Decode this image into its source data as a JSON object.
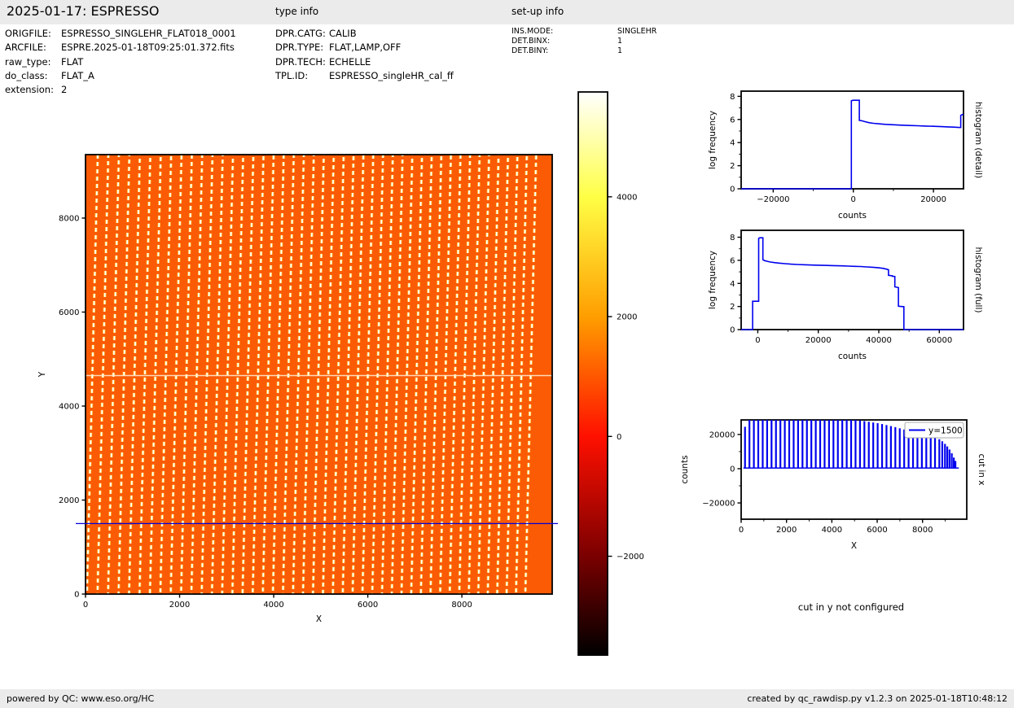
{
  "header": {
    "title": "2025-01-17: ESPRESSO",
    "type_info_label": "type info",
    "setup_info_label": "set-up info"
  },
  "file_info": {
    "rows": [
      {
        "label": "ORIGFILE:",
        "value": "ESPRESSO_SINGLEHR_FLAT018_0001"
      },
      {
        "label": "ARCFILE:",
        "value": "ESPRE.2025-01-18T09:25:01.372.fits"
      },
      {
        "label": "raw_type:",
        "value": "FLAT"
      },
      {
        "label": "do_class:",
        "value": "FLAT_A"
      },
      {
        "label": "extension:",
        "value": "2"
      }
    ]
  },
  "type_info": {
    "rows": [
      {
        "label": "DPR.CATG:",
        "value": "CALIB"
      },
      {
        "label": "DPR.TYPE:",
        "value": "FLAT,LAMP,OFF"
      },
      {
        "label": "DPR.TECH:",
        "value": "ECHELLE"
      },
      {
        "label": "TPL.ID:",
        "value": "ESPRESSO_singleHR_cal_ff"
      }
    ]
  },
  "setup_info": {
    "rows": [
      {
        "label": "INS.MODE:",
        "value": "SINGLEHR"
      },
      {
        "label": "DET.BINX:",
        "value": "1"
      },
      {
        "label": "DET.BINY:",
        "value": "1"
      }
    ]
  },
  "footer": {
    "left": "powered by QC: www.eso.org/HC",
    "right": "created by qc_rawdisp.py v1.2.3 on 2025-01-18T10:48:12"
  },
  "colors": {
    "accent_blue": "#0000ee",
    "image_orange": "#fa5b04",
    "bar_gray": "#ebebeb"
  },
  "chart_data": [
    {
      "id": "main-image",
      "type": "heatmap",
      "description": "ESPRESSO raw flat-field frame: near-vertical dashed echelle order traces (white/yellow) on orange background, hot colormap",
      "xlabel": "X",
      "ylabel": "Y",
      "xlim": [
        0,
        9920
      ],
      "ylim": [
        0,
        9350
      ],
      "xticks": [
        0,
        2000,
        4000,
        6000,
        8000
      ],
      "yticks": [
        0,
        2000,
        4000,
        6000,
        8000
      ],
      "bg_color": "#fa5b04",
      "orders": {
        "count": 45,
        "first_top_x": 260,
        "spacing": 225,
        "spacing_shrink": 0.3,
        "tilt_dx": -230,
        "dash_color": "#ffffff",
        "fringe_color": "#ffce45"
      },
      "detector_gap_y": 4650,
      "cut_line": {
        "y": 1500,
        "color": "#0000dd"
      }
    },
    {
      "id": "colorbar",
      "type": "colorbar",
      "colormap": "hot",
      "vmin": -3650,
      "vmax": 5750,
      "ticks": [
        4000,
        2000,
        0,
        -2000
      ],
      "gradient_stops": [
        [
          0.0,
          "#000000"
        ],
        [
          0.176,
          "#7b0000"
        ],
        [
          0.388,
          "#ff1000"
        ],
        [
          0.601,
          "#ff9e00"
        ],
        [
          0.814,
          "#ffff46"
        ],
        [
          1.0,
          "#ffffff"
        ]
      ]
    },
    {
      "id": "hist-detail",
      "type": "line",
      "xlabel": "counts",
      "ylabel": "log frequency",
      "right_label": "histogram (detail)",
      "xlim": [
        -28000,
        27500
      ],
      "ylim": [
        0,
        8.45
      ],
      "xticks": [
        -20000,
        0,
        20000
      ],
      "xminor": [
        -10000,
        10000
      ],
      "yticks": [
        0,
        2,
        4,
        6,
        8
      ],
      "yminor": [
        1,
        3,
        5,
        7
      ],
      "color": "#0000ee",
      "points": [
        [
          -28000,
          0
        ],
        [
          -500,
          0
        ],
        [
          -500,
          7.62
        ],
        [
          -100,
          7.66
        ],
        [
          1500,
          7.66
        ],
        [
          1500,
          5.92
        ],
        [
          2200,
          5.88
        ],
        [
          3000,
          5.8
        ],
        [
          4000,
          5.72
        ],
        [
          5000,
          5.67
        ],
        [
          6500,
          5.62
        ],
        [
          8000,
          5.58
        ],
        [
          10000,
          5.54
        ],
        [
          12000,
          5.51
        ],
        [
          14000,
          5.48
        ],
        [
          16000,
          5.46
        ],
        [
          18000,
          5.43
        ],
        [
          20000,
          5.41
        ],
        [
          22000,
          5.38
        ],
        [
          23500,
          5.36
        ],
        [
          25000,
          5.34
        ],
        [
          26300,
          5.31
        ],
        [
          26800,
          5.3
        ],
        [
          26800,
          6.35
        ],
        [
          27200,
          6.42
        ],
        [
          27500,
          6.45
        ]
      ]
    },
    {
      "id": "hist-full",
      "type": "line",
      "xlabel": "counts",
      "ylabel": "log frequency",
      "right_label": "histogram (full)",
      "xlim": [
        -5500,
        68000
      ],
      "ylim": [
        0,
        8.6
      ],
      "xticks": [
        0,
        20000,
        40000,
        60000
      ],
      "xminor": [
        10000,
        30000,
        50000
      ],
      "yticks": [
        0,
        2,
        4,
        6,
        8
      ],
      "yminor": [
        1,
        3,
        5,
        7
      ],
      "color": "#0000ee",
      "points": [
        [
          -5500,
          0
        ],
        [
          -1700,
          0
        ],
        [
          -1700,
          2.45
        ],
        [
          300,
          2.45
        ],
        [
          300,
          7.9
        ],
        [
          700,
          7.95
        ],
        [
          1700,
          7.95
        ],
        [
          1700,
          6.05
        ],
        [
          2200,
          5.98
        ],
        [
          3000,
          5.92
        ],
        [
          4000,
          5.86
        ],
        [
          5500,
          5.8
        ],
        [
          7000,
          5.76
        ],
        [
          9000,
          5.71
        ],
        [
          11000,
          5.67
        ],
        [
          13000,
          5.64
        ],
        [
          16000,
          5.61
        ],
        [
          19000,
          5.58
        ],
        [
          22000,
          5.56
        ],
        [
          25000,
          5.54
        ],
        [
          28000,
          5.52
        ],
        [
          30000,
          5.5
        ],
        [
          32000,
          5.48
        ],
        [
          34000,
          5.46
        ],
        [
          36000,
          5.43
        ],
        [
          38000,
          5.4
        ],
        [
          40000,
          5.35
        ],
        [
          41500,
          5.3
        ],
        [
          42500,
          5.24
        ],
        [
          43200,
          5.18
        ],
        [
          43200,
          4.7
        ],
        [
          44500,
          4.66
        ],
        [
          44500,
          4.62
        ],
        [
          45300,
          4.6
        ],
        [
          45300,
          3.7
        ],
        [
          46500,
          3.64
        ],
        [
          46500,
          2.02
        ],
        [
          48300,
          1.98
        ],
        [
          48300,
          0
        ],
        [
          68000,
          0
        ]
      ]
    },
    {
      "id": "cut-x",
      "type": "spikes",
      "xlabel": "X",
      "ylabel": "counts",
      "right_label": "cut in x",
      "legend_label": "y=1500",
      "xlim": [
        0,
        9950
      ],
      "ylim": [
        -29500,
        28500
      ],
      "xticks": [
        0,
        2000,
        4000,
        6000,
        8000
      ],
      "xminor": [
        1000,
        3000,
        5000,
        7000,
        9000
      ],
      "yticks": [
        -20000,
        0,
        20000
      ],
      "yminor": [
        -10000,
        10000
      ],
      "baseline": 400,
      "color": "#0000ee",
      "spikes": [
        [
          170,
          24500
        ],
        [
          365,
          28500
        ],
        [
          560,
          28500
        ],
        [
          755,
          28500
        ],
        [
          950,
          28500
        ],
        [
          1145,
          28500
        ],
        [
          1340,
          28500
        ],
        [
          1535,
          28500
        ],
        [
          1730,
          28500
        ],
        [
          1925,
          28500
        ],
        [
          2120,
          28500
        ],
        [
          2315,
          28500
        ],
        [
          2510,
          28500
        ],
        [
          2705,
          28500
        ],
        [
          2900,
          28500
        ],
        [
          3095,
          28500
        ],
        [
          3290,
          28500
        ],
        [
          3485,
          28500
        ],
        [
          3680,
          28500
        ],
        [
          3875,
          28500
        ],
        [
          4070,
          28500
        ],
        [
          4265,
          28500
        ],
        [
          4460,
          28500
        ],
        [
          4655,
          28500
        ],
        [
          4850,
          28500
        ],
        [
          5045,
          28500
        ],
        [
          5240,
          28200
        ],
        [
          5435,
          27800
        ],
        [
          5630,
          27400
        ],
        [
          5825,
          27000
        ],
        [
          6020,
          26600
        ],
        [
          6215,
          26100
        ],
        [
          6410,
          25500
        ],
        [
          6605,
          24900
        ],
        [
          6800,
          24300
        ],
        [
          6995,
          23600
        ],
        [
          7190,
          22900
        ],
        [
          7385,
          22100
        ],
        [
          7580,
          21300
        ],
        [
          7775,
          20500
        ],
        [
          7970,
          19800
        ],
        [
          8165,
          19300
        ],
        [
          8360,
          19000
        ],
        [
          8550,
          18500
        ],
        [
          8740,
          17200
        ],
        [
          8870,
          16000
        ],
        [
          8990,
          14500
        ],
        [
          9090,
          13000
        ],
        [
          9190,
          11200
        ],
        [
          9290,
          9000
        ],
        [
          9380,
          6500
        ],
        [
          9450,
          4500
        ]
      ]
    },
    {
      "id": "cut-y-note",
      "type": "text",
      "text": "cut in y not configured"
    }
  ]
}
